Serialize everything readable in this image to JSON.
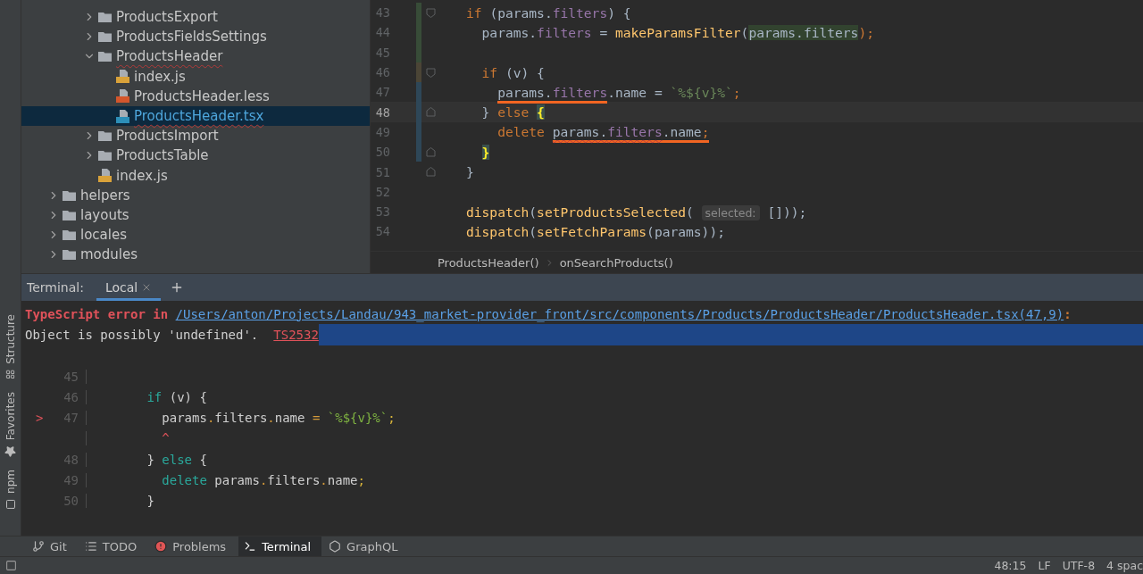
{
  "project_tree": {
    "items": [
      {
        "children": [
          {
            "children": [
              {
                "name": "ProductsExport",
                "kind": "folder",
                "expanded": false,
                "selected": false,
                "error": false
              },
              {
                "name": "ProductsFieldsSettings",
                "kind": "folder",
                "expanded": false,
                "selected": false,
                "error": false
              },
              {
                "name": "ProductsHeader",
                "kind": "folder",
                "expanded": true,
                "selected": false,
                "error": true,
                "children": [
                  {
                    "name": "index.js",
                    "kind": "js",
                    "selected": false,
                    "error": false
                  },
                  {
                    "name": "ProductsHeader.less",
                    "kind": "less",
                    "selected": false,
                    "error": false
                  },
                  {
                    "name": "ProductsHeader.tsx",
                    "kind": "tsx",
                    "selected": true,
                    "error": true
                  }
                ]
              },
              {
                "name": "ProductsImport",
                "kind": "folder",
                "expanded": false,
                "selected": false,
                "error": false
              },
              {
                "name": "ProductsTable",
                "kind": "folder",
                "expanded": false,
                "selected": false,
                "error": false
              },
              {
                "name": "index.js",
                "kind": "js",
                "selected": false,
                "error": false
              }
            ]
          }
        ]
      },
      {
        "name": "helpers",
        "kind": "folder",
        "expanded": false,
        "selected": false,
        "error": false
      },
      {
        "name": "layouts",
        "kind": "folder",
        "expanded": false,
        "selected": false,
        "error": false
      },
      {
        "name": "locales",
        "kind": "folder",
        "expanded": false,
        "selected": false,
        "error": false
      },
      {
        "name": "modules",
        "kind": "folder",
        "expanded": false,
        "selected": false,
        "error": false
      }
    ]
  },
  "editor": {
    "lines": [
      {
        "number": "43",
        "color": "#384c38",
        "fold_open": true,
        "fold_close": false,
        "current": false,
        "tokens": [
          {
            "text": "if",
            "kind": "kw"
          },
          {
            "text": " (params.",
            "kind": "plain"
          },
          {
            "text": "filters",
            "kind": "field"
          },
          {
            "text": ") {",
            "kind": "plain"
          }
        ]
      },
      {
        "number": "44",
        "color": "#384c38",
        "fold_open": false,
        "fold_close": false,
        "current": false,
        "tokens": [
          {
            "text": "  params.",
            "kind": "plain"
          },
          {
            "text": "filters",
            "kind": "field"
          },
          {
            "text": " = ",
            "kind": "plain"
          },
          {
            "text": "makeParamsFilter",
            "kind": "fn"
          },
          {
            "text": "(",
            "kind": "plain"
          },
          {
            "text": "params.filters",
            "kind": "ref"
          },
          {
            "text": ");",
            "kind": "punct"
          }
        ]
      },
      {
        "number": "45",
        "color": "#384c38",
        "fold_open": false,
        "fold_close": false,
        "current": false
      },
      {
        "number": "46",
        "color": "#4b4536",
        "fold_open": true,
        "fold_close": false,
        "current": false,
        "tokens": [
          {
            "text": "  if",
            "kind": "kw"
          },
          {
            "text": " (v) {",
            "kind": "plain"
          }
        ]
      },
      {
        "number": "47",
        "color": "#2e4758",
        "fold_open": false,
        "fold_close": false,
        "current": false,
        "tokens": [
          {
            "marked": true,
            "tokens": [
              {
                "text": "    params.",
                "kind": "plain"
              },
              {
                "text": "filters",
                "kind": "field"
              }
            ]
          },
          {
            "text": ".name = ",
            "kind": "plain"
          },
          {
            "text": "`%${v}%`",
            "kind": "str"
          },
          {
            "text": ";",
            "kind": "punct"
          }
        ]
      },
      {
        "number": "48",
        "color": "#2e4758",
        "fold_open": false,
        "fold_close": true,
        "current": true,
        "tokens": [
          {
            "text": "  } ",
            "kind": "plain"
          },
          {
            "text": "else ",
            "kind": "kw"
          },
          {
            "text": "{",
            "kind": "brace"
          }
        ]
      },
      {
        "number": "49",
        "color": "#2e4758",
        "fold_open": false,
        "fold_close": false,
        "current": false,
        "tokens": [
          {
            "text": "    delete ",
            "kind": "kw"
          },
          {
            "marked": true,
            "tokens": [
              {
                "text": "params.",
                "kind": "plain",
                "squiggle": true
              },
              {
                "text": "filters",
                "kind": "field",
                "squiggle": true
              },
              {
                "text": ".name",
                "kind": "plain"
              },
              {
                "text": ";",
                "kind": "punct"
              }
            ]
          }
        ]
      },
      {
        "number": "50",
        "color": "#2e4758",
        "fold_open": false,
        "fold_close": true,
        "current": false,
        "tokens": [
          {
            "text": "  }",
            "kind": "brace"
          }
        ]
      },
      {
        "number": "51",
        "fold_open": false,
        "fold_close": true,
        "current": false,
        "tokens": [
          {
            "text": "}",
            "kind": "plain"
          }
        ]
      },
      {
        "number": "52",
        "fold_open": false,
        "fold_close": false,
        "current": false
      },
      {
        "number": "53",
        "fold_open": false,
        "fold_close": false,
        "current": false,
        "tokens": [
          {
            "text": "dispatch",
            "kind": "fn"
          },
          {
            "text": "(",
            "kind": "plain"
          },
          {
            "text": "setProductsSelected",
            "kind": "fn"
          },
          {
            "text": "( ",
            "kind": "plain"
          },
          {
            "text": "selected:",
            "kind": "hint"
          },
          {
            "text": " []));",
            "kind": "plain"
          }
        ]
      },
      {
        "number": "54",
        "fold_open": false,
        "fold_close": false,
        "current": false,
        "tokens": [
          {
            "text": "dispatch",
            "kind": "fn"
          },
          {
            "text": "(",
            "kind": "plain"
          },
          {
            "text": "setFetchParams",
            "kind": "fn"
          },
          {
            "text": "(params));",
            "kind": "plain"
          }
        ]
      }
    ],
    "breadcrumbs": [
      "ProductsHeader()",
      "onSearchProducts()"
    ]
  },
  "terminal": {
    "title": "Terminal:",
    "tabs": [
      {
        "label": "Local",
        "selected": true
      }
    ],
    "error": {
      "prefix": "TypeScript error in ",
      "path": "/Users/anton/Projects/Landau/943_market-provider_front/src/components/Products/ProductsHeader/ProductsHeader.tsx(47,9)",
      "suffix": ":"
    },
    "message": {
      "text": "Object is possibly 'undefined'.",
      "code": "TS2532",
      "highlighted": true
    },
    "excerpt": [
      {
        "number": "45"
      },
      {
        "number": "46",
        "tokens": [
          {
            "text": "        if",
            "kind": "kw"
          },
          {
            "text": " (v) {",
            "kind": "plain"
          }
        ]
      },
      {
        "marker": ">",
        "number": "47",
        "tokens": [
          {
            "text": "          params",
            "kind": "plain"
          },
          {
            "text": ".",
            "kind": "op"
          },
          {
            "text": "filters",
            "kind": "plain"
          },
          {
            "text": ".",
            "kind": "op"
          },
          {
            "text": "name ",
            "kind": "plain"
          },
          {
            "text": "=",
            "kind": "op"
          },
          {
            "text": " `%${v}%`",
            "kind": "str"
          },
          {
            "text": ";",
            "kind": "semi"
          }
        ]
      },
      {
        "tokens": [
          {
            "text": "          ^",
            "kind": "caret"
          }
        ]
      },
      {
        "number": "48",
        "tokens": [
          {
            "text": "        } ",
            "kind": "plain"
          },
          {
            "text": "else",
            "kind": "kw"
          },
          {
            "text": " {",
            "kind": "plain"
          }
        ]
      },
      {
        "number": "49",
        "tokens": [
          {
            "text": "          delete",
            "kind": "kw"
          },
          {
            "text": " params",
            "kind": "plain"
          },
          {
            "text": ".",
            "kind": "op"
          },
          {
            "text": "filters",
            "kind": "plain"
          },
          {
            "text": ".",
            "kind": "op"
          },
          {
            "text": "name",
            "kind": "plain"
          },
          {
            "text": ";",
            "kind": "semi"
          }
        ]
      },
      {
        "number": "50",
        "tokens": [
          {
            "text": "        }",
            "kind": "plain"
          }
        ]
      }
    ]
  },
  "left_tools": [
    {
      "label": "Structure",
      "kind": "structure"
    },
    {
      "label": "Favorites",
      "kind": "favorites"
    },
    {
      "label": "npm",
      "kind": "npm"
    }
  ],
  "bottom_tools": [
    {
      "label": "Git",
      "kind": "git",
      "selected": false
    },
    {
      "label": "TODO",
      "kind": "todo",
      "selected": false
    },
    {
      "label": "Problems",
      "kind": "problems",
      "selected": false
    },
    {
      "label": "Terminal",
      "kind": "terminal",
      "selected": true
    },
    {
      "label": "GraphQL",
      "kind": "graphql",
      "selected": false
    }
  ],
  "status_bar": {
    "items": [
      "48:15",
      "LF",
      "UTF-8",
      "4 spac"
    ]
  }
}
